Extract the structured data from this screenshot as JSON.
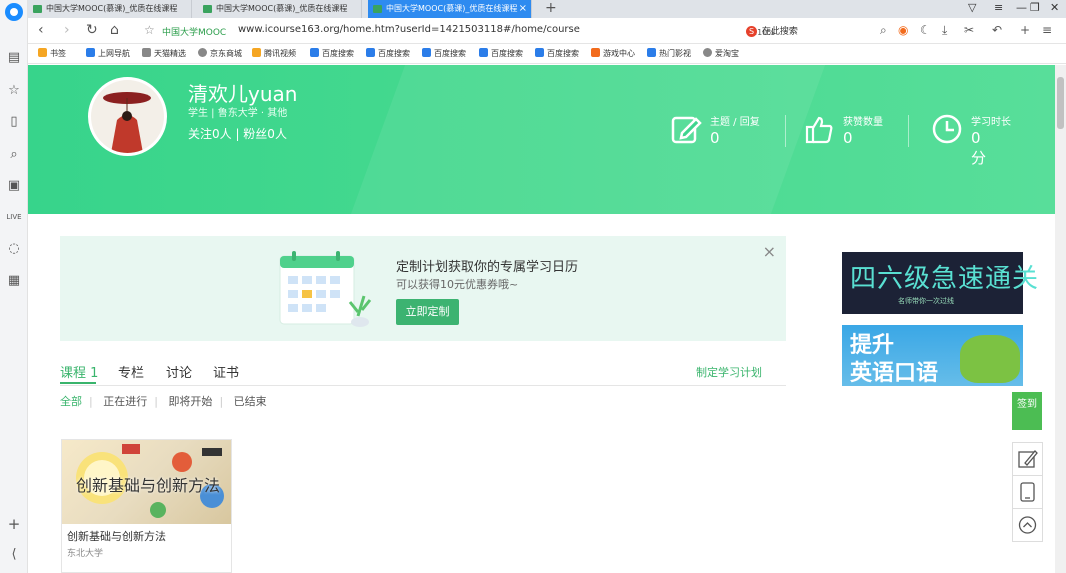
{
  "browser": {
    "tabs": [
      {
        "label": "中国大学MOOC(慕课)_优质在线课程"
      },
      {
        "label": "中国大学MOOC(慕课)_优质在线课程"
      },
      {
        "label": "中国大学MOOC(慕课)_优质在线课程"
      }
    ],
    "address": {
      "site_label": "中国大学MOOC",
      "url": "www.icourse163.org/home.htm?userId=1421503118#/home/course",
      "zoom": "110%",
      "search_placeholder": "在此搜索"
    },
    "bookmarks": [
      {
        "label": "书签",
        "icon": "star-icon",
        "color": "#f5a623"
      },
      {
        "label": "上网导航",
        "icon": "e-icon",
        "color": "#2b7de9"
      },
      {
        "label": "天猫精选",
        "icon": "tmall-icon",
        "color": "#888888"
      },
      {
        "label": "京东商城",
        "icon": "globe-icon",
        "color": "#888888"
      },
      {
        "label": "腾讯视频",
        "icon": "video-icon",
        "color": "#f5a623"
      },
      {
        "label": "百度搜索",
        "icon": "baidu-icon",
        "color": "#2b7de9"
      },
      {
        "label": "百度搜索",
        "icon": "baidu-icon",
        "color": "#2b7de9"
      },
      {
        "label": "百度搜索",
        "icon": "baidu-icon",
        "color": "#2b7de9"
      },
      {
        "label": "百度搜索",
        "icon": "baidu-icon",
        "color": "#2b7de9"
      },
      {
        "label": "百度搜索",
        "icon": "baidu-icon",
        "color": "#2b7de9"
      },
      {
        "label": "游戏中心",
        "icon": "game-icon",
        "color": "#f26b1d"
      },
      {
        "label": "热门影视",
        "icon": "play-icon",
        "color": "#2b7de9"
      },
      {
        "label": "爱淘宝",
        "icon": "globe-icon",
        "color": "#888888"
      }
    ]
  },
  "profile": {
    "name": "清欢儿yuan",
    "role": "学生 | 鲁东大学 · 其他",
    "follow": "关注0人 | 粉丝0人",
    "stats": [
      {
        "label": "主题 / 回复",
        "value": "0",
        "icon": "edit-icon"
      },
      {
        "label": "获赞数量",
        "value": "0",
        "icon": "thumbs-up-icon"
      },
      {
        "label": "学习时长",
        "value": "0分",
        "icon": "clock-icon"
      }
    ]
  },
  "promo": {
    "title": "定制计划获取你的专属学习日历",
    "subtitle": "可以获得10元优惠券哦~",
    "button": "立即定制",
    "close": "×"
  },
  "tabs": {
    "items": [
      "课程 1",
      "专栏",
      "讨论",
      "证书"
    ],
    "plan_link": "制定学习计划"
  },
  "filters": [
    "全部",
    "正在进行",
    "即将开始",
    "已结束"
  ],
  "course": {
    "thumb_text": "创新基础与创新方法",
    "title": "创新基础与创新方法",
    "school": "东北大学"
  },
  "ads": {
    "ad1_title": "四六级急速通关",
    "ad1_sub": "名师带你一次过线",
    "ad2_line1": "提升",
    "ad2_line2": "英语口语"
  },
  "floating": {
    "signin": "签到"
  },
  "colors": {
    "brand_green": "#39b46c",
    "hero_green": "#3ed58e",
    "tab_active": "#2e8bf0"
  }
}
